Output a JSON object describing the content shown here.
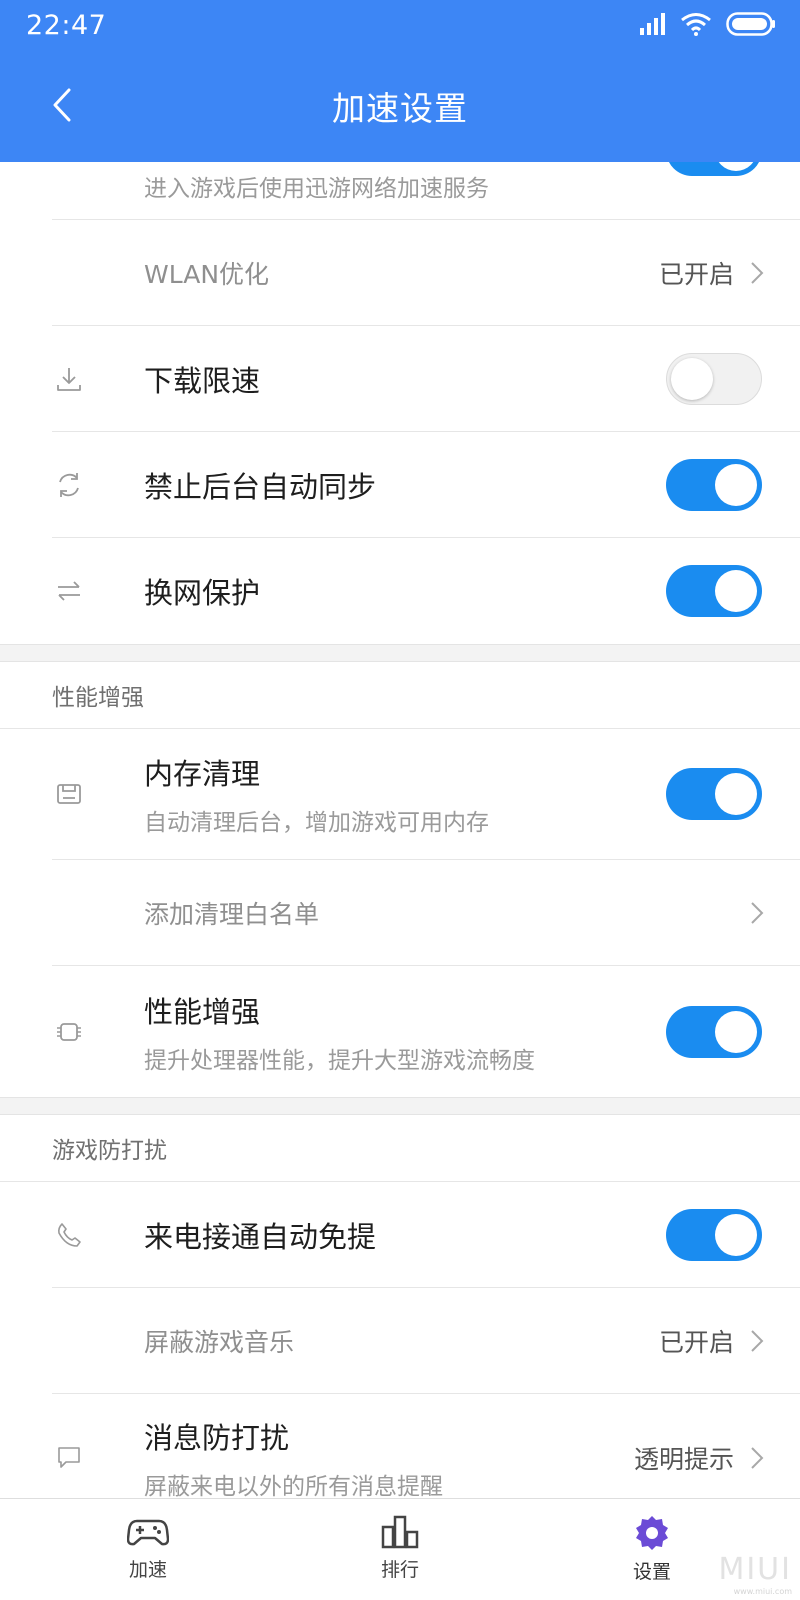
{
  "status": {
    "time": "22:47"
  },
  "header": {
    "title": "加速设置"
  },
  "colors": {
    "accent": "#3d86f5",
    "toggle_on": "#1a8cf0",
    "nav_active": "#6b4bd6"
  },
  "rows": {
    "partial": {
      "subtitle": "进入游戏后使用迅游网络加速服务",
      "enabled": true
    },
    "wlan": {
      "label": "WLAN优化",
      "value": "已开启"
    },
    "download_limit": {
      "title": "下载限速",
      "enabled": false,
      "icon": "download-icon"
    },
    "bg_sync": {
      "title": "禁止后台自动同步",
      "enabled": true,
      "icon": "sync-icon"
    },
    "net_switch": {
      "title": "换网保护",
      "enabled": true,
      "icon": "swap-icon"
    }
  },
  "sections": {
    "performance": {
      "header": "性能增强",
      "memory_clean": {
        "title": "内存清理",
        "subtitle": "自动清理后台，增加游戏可用内存",
        "enabled": true,
        "icon": "memory-icon"
      },
      "whitelist": {
        "label": "添加清理白名单"
      },
      "perf_boost": {
        "title": "性能增强",
        "subtitle": "提升处理器性能，提升大型游戏流畅度",
        "enabled": true,
        "icon": "chip-icon"
      }
    },
    "dnd": {
      "header": "游戏防打扰",
      "call_handsfree": {
        "title": "来电接通自动免提",
        "enabled": true,
        "icon": "phone-icon"
      },
      "mute_music": {
        "label": "屏蔽游戏音乐",
        "value": "已开启"
      },
      "msg_dnd": {
        "title": "消息防打扰",
        "subtitle": "屏蔽来电以外的所有消息提醒",
        "value": "透明提示",
        "icon": "message-icon"
      }
    }
  },
  "bottom_nav": {
    "items": [
      {
        "label": "加速",
        "icon": "gamepad-icon"
      },
      {
        "label": "排行",
        "icon": "ranking-icon"
      },
      {
        "label": "设置",
        "icon": "settings-icon",
        "active": true
      }
    ]
  },
  "watermark": {
    "text": "MIUI",
    "sub": "www.miui.com"
  }
}
